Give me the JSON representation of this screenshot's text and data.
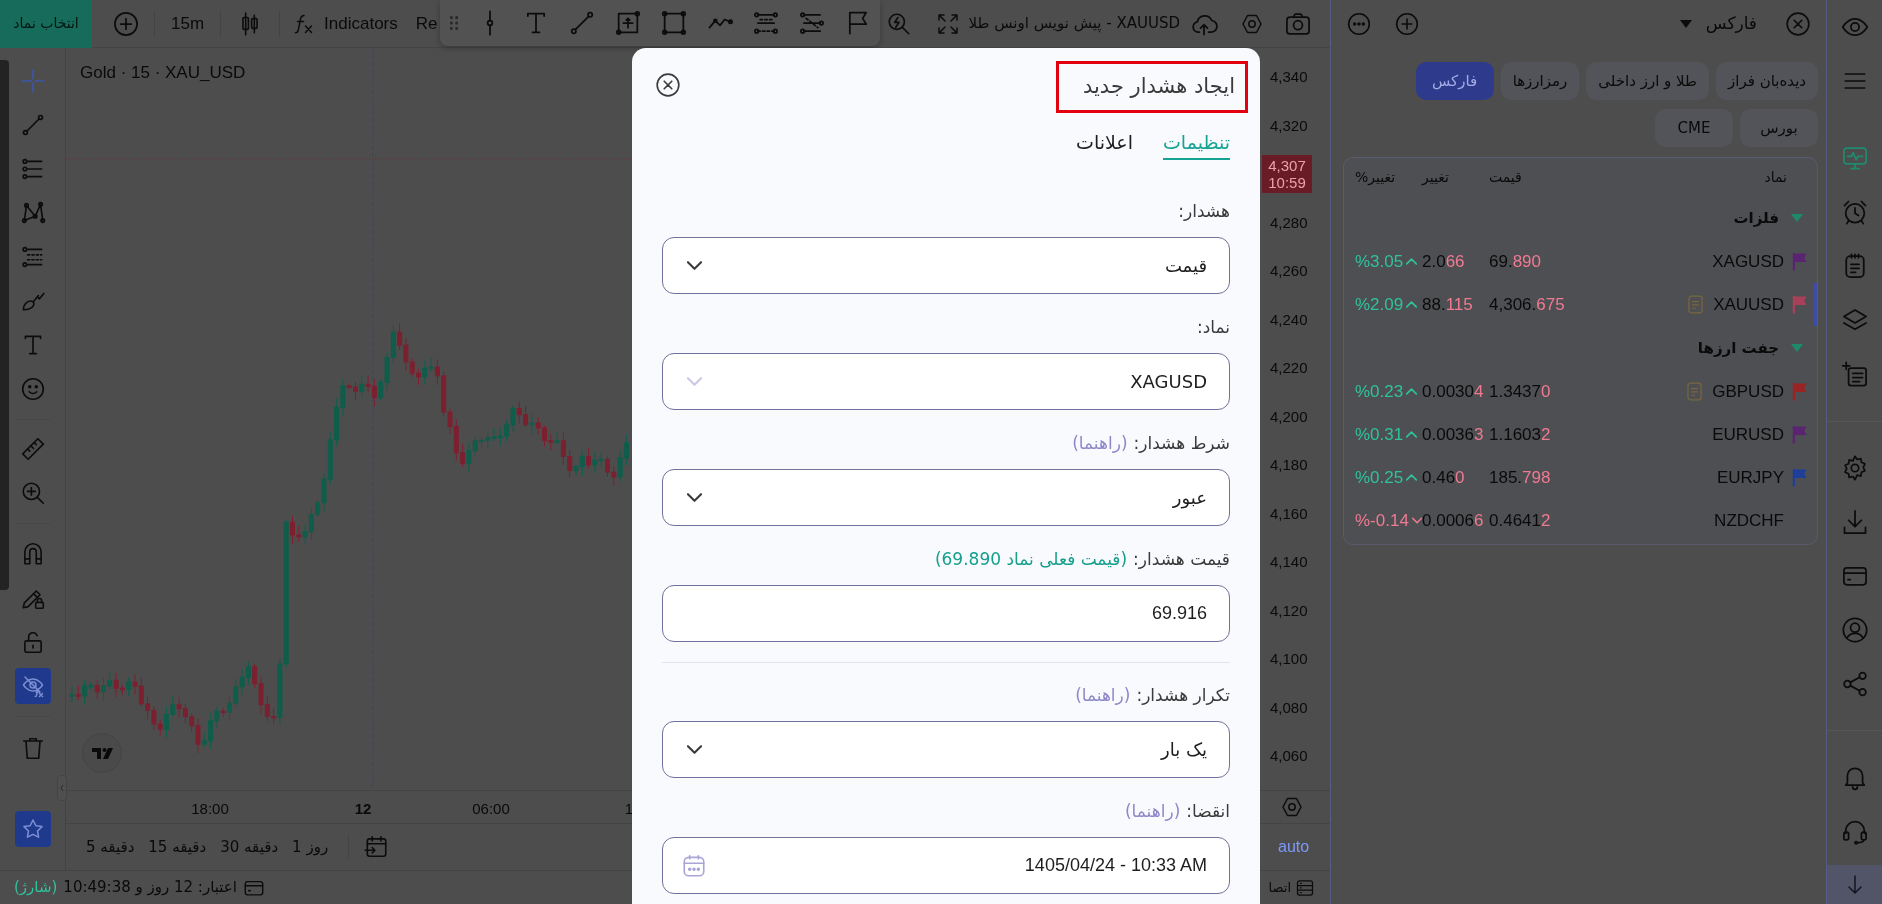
{
  "top_bar": {
    "symbol_button": "انتخاب نماد",
    "interval": "15m",
    "indicators": "Indicators",
    "replay": "Re",
    "chart_name": "XAUUSD - پیش نویس اونس طلا"
  },
  "left_toolbar": {
    "tools": [
      {
        "selected": true
      },
      {
        "selected": false
      },
      {
        "selected": false
      },
      {
        "selected": false
      },
      {
        "selected": false
      },
      {
        "selected": false
      },
      {
        "selected": false
      },
      {
        "selected": false
      },
      {
        "selected": false
      },
      {
        "selected": false
      }
    ],
    "toggles": [
      {
        "on": false
      },
      {
        "on": false
      },
      {
        "on": false
      },
      {
        "on": true
      }
    ],
    "favorites": {
      "on": true
    }
  },
  "chart": {
    "legend": "Gold · 15 · XAU_USD",
    "price_axis": [
      "4,340",
      "4,320",
      "4,280",
      "4,260",
      "4,240",
      "4,220",
      "4,200",
      "4,180",
      "4,160",
      "4,140",
      "4,120",
      "4,100",
      "4,080",
      "4,060"
    ],
    "last_price": {
      "price": "4,307",
      "countdown": "10:59"
    },
    "time_axis": [
      {
        "label": "1",
        "bold": false
      },
      {
        "label": "06:00",
        "bold": false
      },
      {
        "label": "12",
        "bold": true
      },
      {
        "label": "18:00",
        "bold": false
      }
    ],
    "scale_mode": "auto"
  },
  "timeframes": [
    "1 روز",
    "30 دقیقه",
    "15 دقیقه",
    "5 دقیقه"
  ],
  "status_bar": {
    "credit": "اعتبار: 12 روز و 10:49:38",
    "charge_link": "(شارژ)",
    "connection": "اتصا"
  },
  "watchlist": {
    "title": "فارکس",
    "tabs": [
      {
        "label": "دیده‌بان فراز",
        "selected": false
      },
      {
        "label": "طلا و ارز داخلی",
        "selected": false
      },
      {
        "label": "رمزارزها",
        "selected": false
      },
      {
        "label": "فارکس",
        "selected": true
      },
      {
        "label": "بورس",
        "selected": false
      },
      {
        "label": "CME",
        "selected": false
      }
    ],
    "columns": [
      "نماد",
      "قیمت",
      "تغییر",
      "تغییر%"
    ],
    "groups": [
      {
        "name": "فلزات",
        "expanded": true,
        "rows": [
          {
            "symbol": "XAGUSD",
            "color": "#5b2472",
            "has_note": false,
            "selected": false,
            "price": {
              "fixed": "69.",
              "changed": "890"
            },
            "change": {
              "fixed": "2.0",
              "changed": "66"
            },
            "change_pct": "%3.05",
            "rising": true
          },
          {
            "symbol": "XAUUSD",
            "color": "#a8405a",
            "has_note": true,
            "selected": true,
            "price": {
              "fixed": "4,306.",
              "changed": "675"
            },
            "change": {
              "fixed": "88.",
              "changed": "115"
            },
            "change_pct": "%2.09",
            "rising": true
          }
        ]
      },
      {
        "name": "جفت ارزها",
        "expanded": true,
        "rows": [
          {
            "symbol": "GBPUSD",
            "color": "#9a2424",
            "has_note": true,
            "selected": false,
            "price": {
              "fixed": "1.3437",
              "changed": "0"
            },
            "change": {
              "fixed": "0.0030",
              "changed": "4"
            },
            "change_pct": "%0.23",
            "rising": true
          },
          {
            "symbol": "EURUSD",
            "color": "#5b2472",
            "has_note": false,
            "selected": false,
            "price": {
              "fixed": "1.1603",
              "changed": "2"
            },
            "change": {
              "fixed": "0.0036",
              "changed": "3"
            },
            "change_pct": "%0.31",
            "rising": true
          },
          {
            "symbol": "EURJPY",
            "color": "#1f3e9a",
            "has_note": false,
            "selected": false,
            "price": {
              "fixed": "185.",
              "changed": "798"
            },
            "change": {
              "fixed": "0.46",
              "changed": "0"
            },
            "change_pct": "%0.25",
            "rising": true
          },
          {
            "symbol": "NZDCHF",
            "has_note": false,
            "selected": false,
            "price": {
              "fixed": "0.4641",
              "changed": "2"
            },
            "change": {
              "fixed": "0.0006",
              "changed": "6"
            },
            "change_pct": "%-0.14",
            "rising": false
          }
        ]
      }
    ]
  },
  "right_sidebar": [
    {
      "selected": true
    },
    {
      "selected": false
    },
    {
      "selected": false
    },
    {
      "selected": false
    },
    {
      "selected": false
    },
    {
      "selected": false
    },
    {
      "selected": false
    },
    {
      "selected": false
    },
    {
      "selected": false
    },
    {
      "selected": false
    },
    {
      "selected": false
    },
    {
      "selected": false
    }
  ],
  "dialog": {
    "title": "ایجاد هشدار جدید",
    "highlighted": true,
    "tabs": [
      {
        "label": "تنظیمات",
        "selected": true
      },
      {
        "label": "اعلانات",
        "selected": false
      }
    ],
    "fields": [
      {
        "kind": "select",
        "label": "هشدار:",
        "value": "قیمت",
        "disabled": false
      },
      {
        "kind": "select",
        "label": "نماد:",
        "value": "XAGUSD",
        "disabled": true
      },
      {
        "kind": "select",
        "label": "شرط هشدار:",
        "help": "(راهنما)",
        "value": "عبور",
        "disabled": false
      },
      {
        "kind": "input",
        "label": "قیمت هشدار:",
        "current_price": "(قیمت فعلی نماد 69.890)",
        "value": "69.916"
      },
      {
        "kind": "select",
        "label": "تکرار هشدار:",
        "help": "(راهنما)",
        "value": "یک بار",
        "disabled": false
      },
      {
        "kind": "date",
        "label": "انقضا:",
        "help": "(راهنما)",
        "value": "1405/04/24 - 10:33 AM"
      }
    ]
  }
}
